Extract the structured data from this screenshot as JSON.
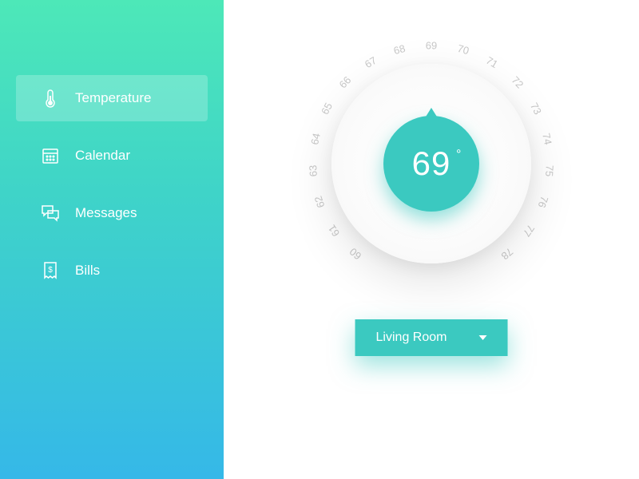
{
  "sidebar": {
    "items": [
      {
        "label": "Temperature",
        "active": true
      },
      {
        "label": "Calendar",
        "active": false
      },
      {
        "label": "Messages",
        "active": false
      },
      {
        "label": "Bills",
        "active": false
      }
    ]
  },
  "dial": {
    "value": "69",
    "degree": "°",
    "scale_min": 60,
    "scale_max": 78
  },
  "room_select": {
    "label": "Living Room"
  },
  "colors": {
    "accent": "#3bc9c0"
  }
}
